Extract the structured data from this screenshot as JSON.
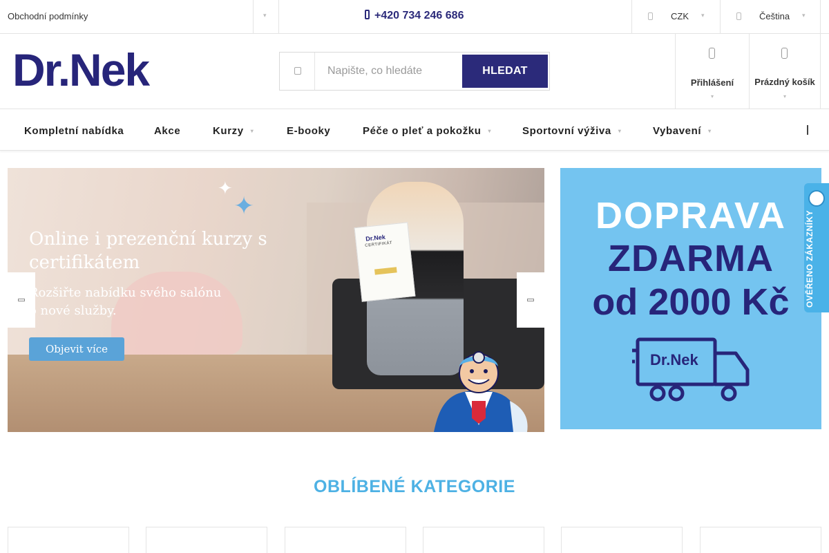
{
  "topbar": {
    "terms_link": "Obchodní podmínky",
    "phone": "+420 734 246 686",
    "currency": "CZK",
    "language": "Čeština"
  },
  "header": {
    "logo_text": "Dr.Nek",
    "search": {
      "placeholder": "Napište, co hledáte",
      "button_label": "HLEDAT"
    },
    "login_label": "Přihlášení",
    "cart_label": "Prázdný košík"
  },
  "nav": {
    "items": [
      {
        "label": "Kompletní nabídka",
        "has_dropdown": false
      },
      {
        "label": "Akce",
        "has_dropdown": false
      },
      {
        "label": "Kurzy",
        "has_dropdown": true
      },
      {
        "label": "E-booky",
        "has_dropdown": false
      },
      {
        "label": "Péče o pleť a pokožku",
        "has_dropdown": true
      },
      {
        "label": "Sportovní výživa",
        "has_dropdown": true
      },
      {
        "label": "Vybavení",
        "has_dropdown": true
      }
    ]
  },
  "hero": {
    "title": "Online i prezenční kurzy s certifikátem",
    "subtitle": "Rozšiřte nabídku svého salónu o nové služby.",
    "cta": "Objevit více",
    "certificate_brand": "Dr.Nek",
    "certificate_title": "CERTIFIKÁT"
  },
  "promo": {
    "line1": "DOPRAVA",
    "line2": "ZDARMA",
    "line3": "od 2000 Kč",
    "truck_logo": "Dr.Nek"
  },
  "badge": {
    "text": "OVĚŘENO ZÁKAZNÍKY"
  },
  "categories": {
    "title": "OBLÍBENÉ KATEGORIE"
  },
  "colors": {
    "brand_navy": "#2b2a7a",
    "accent_blue": "#4db1e4",
    "promo_bg": "#74c4f0"
  }
}
